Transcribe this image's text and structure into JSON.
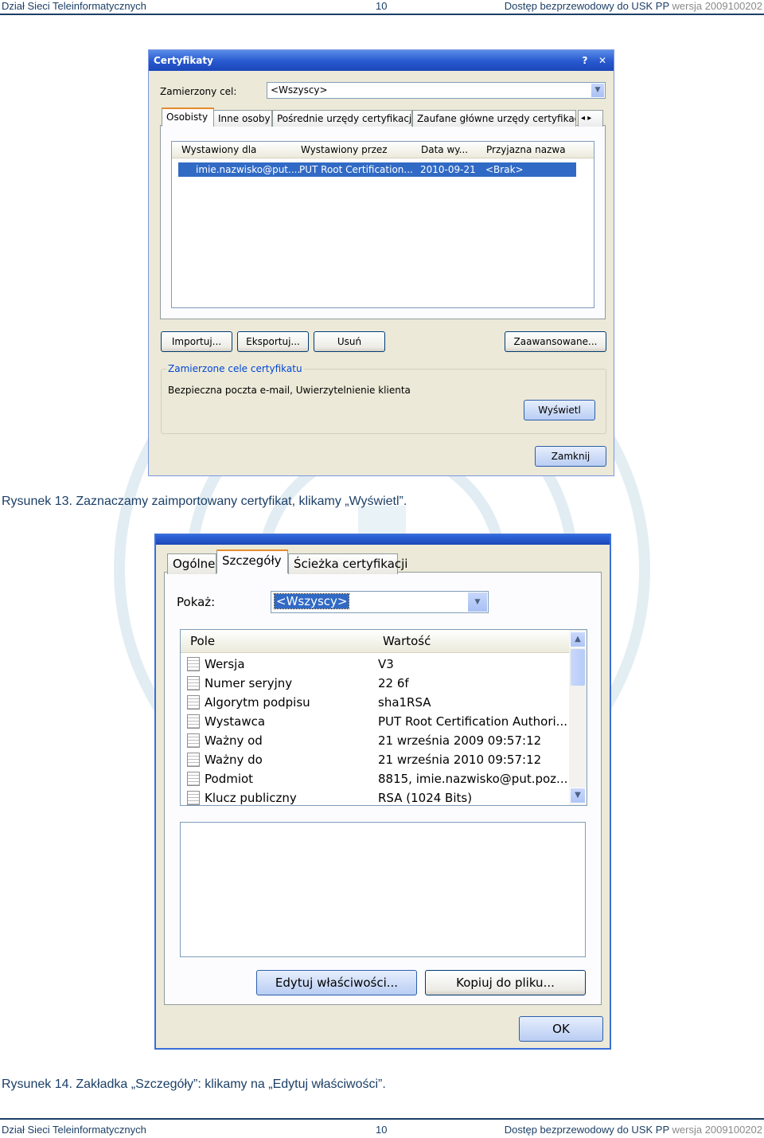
{
  "header": {
    "left": "Dział Sieci Teleinformatycznych",
    "page": "10",
    "right": "Dostęp bezprzewodowy do USK PP",
    "version": "wersja 2009100202"
  },
  "footer": {
    "left": "Dział Sieci Teleinformatycznych",
    "page": "10",
    "right": "Dostęp bezprzewodowy do USK PP",
    "version": "wersja 2009100202"
  },
  "figure1": {
    "caption": "Rysunek 13. Zaznaczamy zaimportowany certyfikat, klikamy „Wyświetl”.",
    "title": "Certyfikaty",
    "help": "?",
    "close": "✕",
    "purpose_label": "Zamierzony cel:",
    "purpose_value": "<Wszyscy>",
    "tabs": [
      "Osobisty",
      "Inne osoby",
      "Pośrednie urzędy certyfikacji",
      "Zaufane główne urzędy certyfikacji"
    ],
    "tab_scroll": "◂ ▸",
    "columns": [
      "Wystawiony dla",
      "Wystawiony przez",
      "Data wy...",
      "Przyjazna nazwa"
    ],
    "row": [
      "imie.nazwisko@put....",
      "PUT Root Certification...",
      "2010-09-21",
      "<Brak>"
    ],
    "buttons": {
      "import": "Importuj...",
      "export": "Eksportuj...",
      "remove": "Usuń",
      "advanced": "Zaawansowane...",
      "view": "Wyświetl",
      "close": "Zamknij"
    },
    "group_label": "Zamierzone cele certyfikatu",
    "group_text": "Bezpieczna poczta e-mail, Uwierzytelnienie klienta"
  },
  "figure2": {
    "caption": "Rysunek 14. Zakładka „Szczegóły”: klikamy na „Edytuj właściwości”.",
    "tabs": [
      "Ogólne",
      "Szczegóły",
      "Ścieżka certyfikacji"
    ],
    "show_label": "Pokaż:",
    "show_value": "<Wszyscy>",
    "columns": [
      "Pole",
      "Wartość"
    ],
    "rows": [
      {
        "field": "Wersja",
        "value": "V3"
      },
      {
        "field": "Numer seryjny",
        "value": "22 6f"
      },
      {
        "field": "Algorytm podpisu",
        "value": "sha1RSA"
      },
      {
        "field": "Wystawca",
        "value": "PUT Root Certification Authori..."
      },
      {
        "field": "Ważny od",
        "value": "21 września 2009 09:57:12"
      },
      {
        "field": "Ważny do",
        "value": "21 września 2010 09:57:12"
      },
      {
        "field": "Podmiot",
        "value": "8815, imie.nazwisko@put.poz..."
      },
      {
        "field": "Klucz publiczny",
        "value": "RSA (1024 Bits)"
      }
    ],
    "buttons": {
      "edit": "Edytuj właściwości...",
      "copy": "Kopiuj do pliku...",
      "ok": "OK"
    }
  },
  "colors": {
    "brand": "#1c3f66",
    "xp_blue": "#2758cf",
    "selection": "#316ac5",
    "dialog_bg": "#ece9d8",
    "watermark": "#d6e6ee"
  }
}
